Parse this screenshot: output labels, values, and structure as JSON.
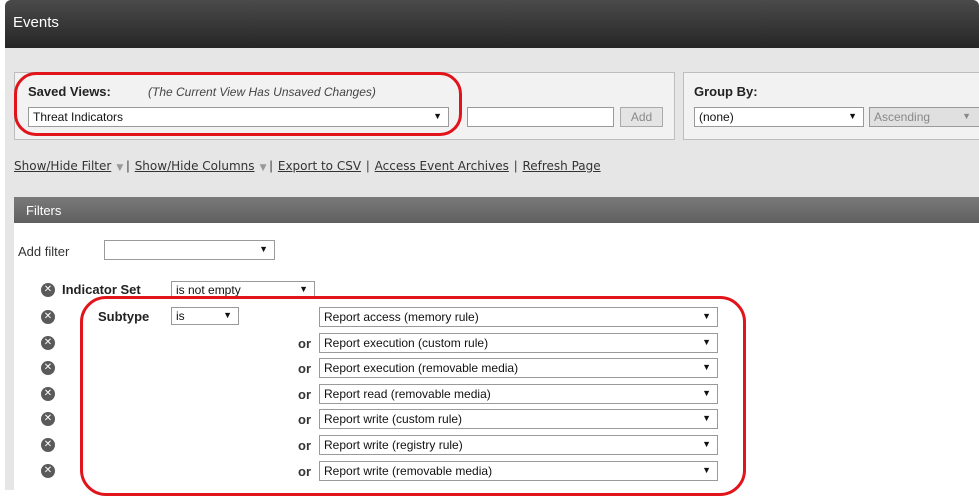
{
  "window": {
    "title": "Events"
  },
  "saved_views": {
    "label": "Saved Views:",
    "note": "(The Current View Has Unsaved Changes)",
    "selected": "Threat Indicators",
    "name_input_value": "",
    "add_label": "Add"
  },
  "group_by": {
    "label": "Group By:",
    "selected": "(none)",
    "order": "Ascending"
  },
  "toolbar": {
    "show_hide_filter": "Show/Hide Filter",
    "show_hide_columns": "Show/Hide Columns",
    "export_csv": "Export to CSV",
    "access_archives": "Access Event Archives",
    "refresh": "Refresh Page",
    "separator": "|"
  },
  "filters": {
    "title": "Filters",
    "add_filter_label": "Add filter",
    "add_filter_value": "",
    "indicator_set": {
      "label": "Indicator Set",
      "operator": "is not empty"
    },
    "subtype": {
      "label": "Subtype",
      "operator": "is",
      "or_label": "or",
      "values": [
        "Report access (memory rule)",
        "Report execution (custom rule)",
        "Report execution (removable media)",
        "Report read (removable media)",
        "Report write (custom rule)",
        "Report write (registry rule)",
        "Report write (removable media)"
      ]
    }
  },
  "colors": {
    "highlight": "#e0141a",
    "titlebar": "#2e2e2e",
    "filters_bar": "#6b6b6b"
  },
  "icons": {
    "remove": "remove-circle-icon",
    "dropdown": "dropdown-arrow-icon"
  }
}
